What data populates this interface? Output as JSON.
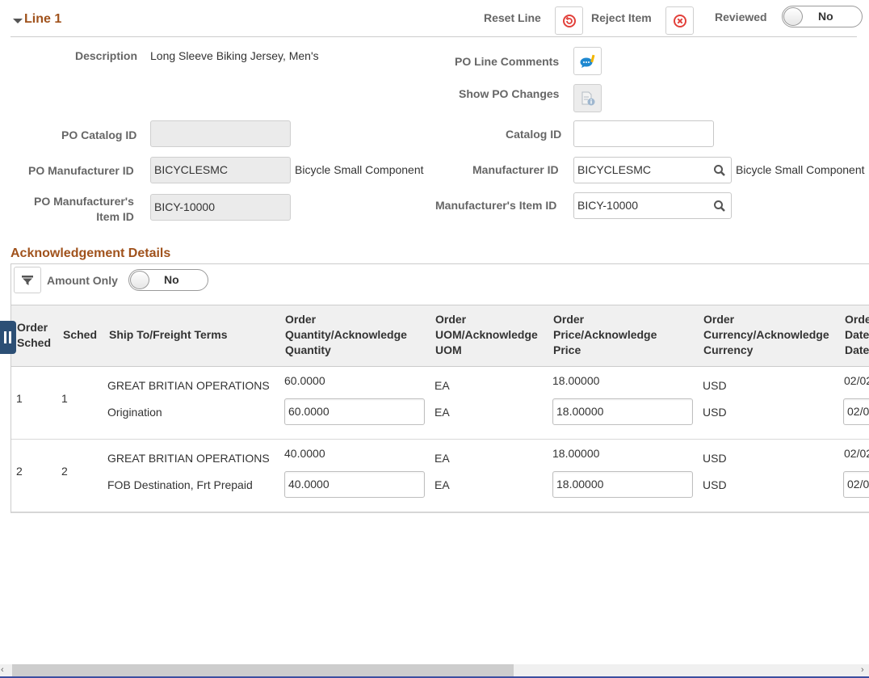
{
  "line_header": {
    "title": "Line 1",
    "reset_line_label": "Reset Line",
    "reject_item_label": "Reject Item",
    "reviewed_label": "Reviewed",
    "reviewed_value": "No"
  },
  "line_details": {
    "description_label": "Description",
    "description_value": "Long Sleeve Biking Jersey, Men's",
    "po_line_comments_label": "PO Line Comments",
    "show_po_changes_label": "Show PO Changes",
    "po_catalog_id_label": "PO Catalog ID",
    "po_catalog_id_value": "",
    "catalog_id_label": "Catalog ID",
    "catalog_id_value": "",
    "po_manufacturer_id_label": "PO Manufacturer ID",
    "po_manufacturer_id_value": "BICYCLESMC",
    "po_manufacturer_desc": "Bicycle Small Component",
    "manufacturer_id_label": "Manufacturer ID",
    "manufacturer_id_value": "BICYCLESMC",
    "manufacturer_desc": "Bicycle Small Component",
    "po_mfg_item_id_label_1": "PO Manufacturer's",
    "po_mfg_item_id_label_2": "Item ID",
    "po_mfg_item_id_value": "BICY-10000",
    "mfg_item_id_label": "Manufacturer's Item ID",
    "mfg_item_id_value": "BICY-10000"
  },
  "ack_details": {
    "title": "Acknowledgement Details",
    "amount_only_label": "Amount Only",
    "amount_only_value": "No",
    "columns": [
      {
        "l1": "Order",
        "l2": "Sched",
        "l3": ""
      },
      {
        "l1": "Sched",
        "l2": "",
        "l3": ""
      },
      {
        "l1": "Ship To/Freight Terms",
        "l2": "",
        "l3": ""
      },
      {
        "l1": "Order",
        "l2": "Quantity/Acknowledge",
        "l3": "Quantity"
      },
      {
        "l1": "Order",
        "l2": "UOM/Acknowledge",
        "l3": "UOM"
      },
      {
        "l1": "Order",
        "l2": "Price/Acknowledge",
        "l3": "Price"
      },
      {
        "l1": "Order",
        "l2": "Currency/Acknowledge",
        "l3": "Currency"
      },
      {
        "l1": "Order",
        "l2": "Date",
        "l3": "Date"
      }
    ],
    "rows": [
      {
        "order_sched": "1",
        "sched": "1",
        "ship_to": "GREAT BRITIAN OPERATIONS",
        "freight_terms": "Origination",
        "order_qty": "60.0000",
        "ack_qty": "60.0000",
        "order_uom": "EA",
        "ack_uom": "EA",
        "order_price": "18.00000",
        "ack_price": "18.00000",
        "order_currency": "USD",
        "ack_currency": "USD",
        "order_date": "02/02",
        "ack_date": "02/0"
      },
      {
        "order_sched": "2",
        "sched": "2",
        "ship_to": "GREAT BRITIAN OPERATIONS",
        "freight_terms": "FOB Destination, Frt Prepaid",
        "order_qty": "40.0000",
        "ack_qty": "40.0000",
        "order_uom": "EA",
        "ack_uom": "EA",
        "order_price": "18.00000",
        "ack_price": "18.00000",
        "order_currency": "USD",
        "ack_currency": "USD",
        "order_date": "02/02",
        "ack_date": "02/0"
      }
    ]
  },
  "colors": {
    "section_title": "#a0521c",
    "label_gray": "#666666",
    "icon_red": "#e2403a",
    "icon_blue": "#1e88d0",
    "grid_tab": "#2c4f75"
  }
}
